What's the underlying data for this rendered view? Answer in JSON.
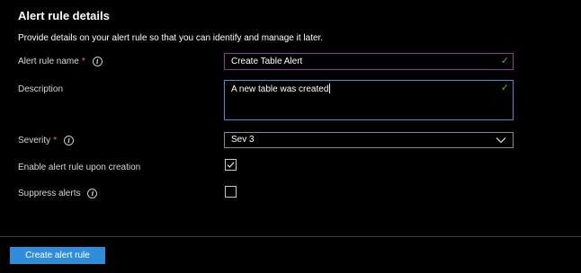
{
  "section": {
    "title": "Alert rule details",
    "description": "Provide details on your alert rule so that you can identify and manage it later."
  },
  "fields": {
    "name": {
      "label": "Alert rule name",
      "required_mark": "*",
      "info_icon": "info-icon",
      "value": "Create Table Alert",
      "valid": true
    },
    "description": {
      "label": "Description",
      "value": "A new table was created",
      "valid": true
    },
    "severity": {
      "label": "Severity",
      "required_mark": "*",
      "info_icon": "info-icon",
      "selected": "Sev 3"
    },
    "enable_on_creation": {
      "label": "Enable alert rule upon creation",
      "checked": true
    },
    "suppress_alerts": {
      "label": "Suppress alerts",
      "info_icon": "info-icon",
      "checked": false
    }
  },
  "footer": {
    "create_button_label": "Create alert rule"
  },
  "colors": {
    "background": "#000000",
    "accent": "#2f8ddc",
    "valid_check": "#3fbf3f",
    "required": "#f1707b",
    "focused_border": "#3e8ed0",
    "hover_border": "#8a3b8f"
  }
}
